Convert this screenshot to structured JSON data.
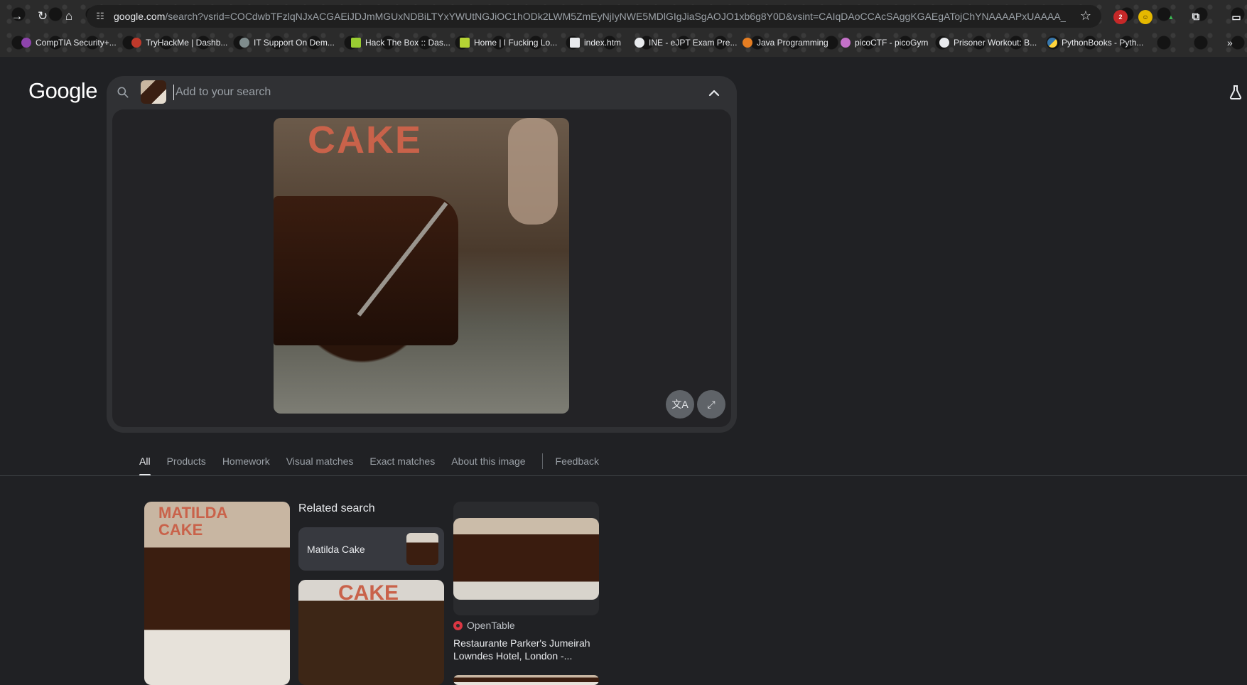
{
  "browser": {
    "url_host": "google.com",
    "url_path": "/search?vsrid=COCdwbTFzlqNJxACGAEiJDJmMGUxNDBiLTYxYWUtNGJiOC1hODk2LWM5ZmEyNjIyNWE5MDlGIgJiaSgAOJO1xb6g8Y0D&vsint=CAIqDAoCCAcSAggKGAEgATojChYNAAAAPxUAAAA_HQAAgD...",
    "bookmarks": [
      "CompTIA Security+...",
      "TryHackMe | Dashb...",
      "IT Support On Dem...",
      "Hack The Box :: Das...",
      "Home | I Fucking Lo...",
      "index.htm",
      "INE - eJPT Exam Pre...",
      "Java Programming",
      "picoCTF - picoGym",
      "Prisoner Workout: B...",
      "PythonBooks - Pyth..."
    ],
    "extension_badge": "2"
  },
  "google": {
    "logo": "Google",
    "search_placeholder": "Add to your search",
    "image_label": "CAKE",
    "tabs": [
      "All",
      "Products",
      "Homework",
      "Visual matches",
      "Exact matches",
      "About this image",
      "Feedback"
    ],
    "related_title": "Related search",
    "related_chip": "Matilda Cake",
    "result_label_a": "MATILDA CAKE",
    "result_label_b": "CAKE",
    "source_name": "OpenTable",
    "result_title": "Restaurante Parker's Jumeirah Lowndes Hotel, London -..."
  }
}
